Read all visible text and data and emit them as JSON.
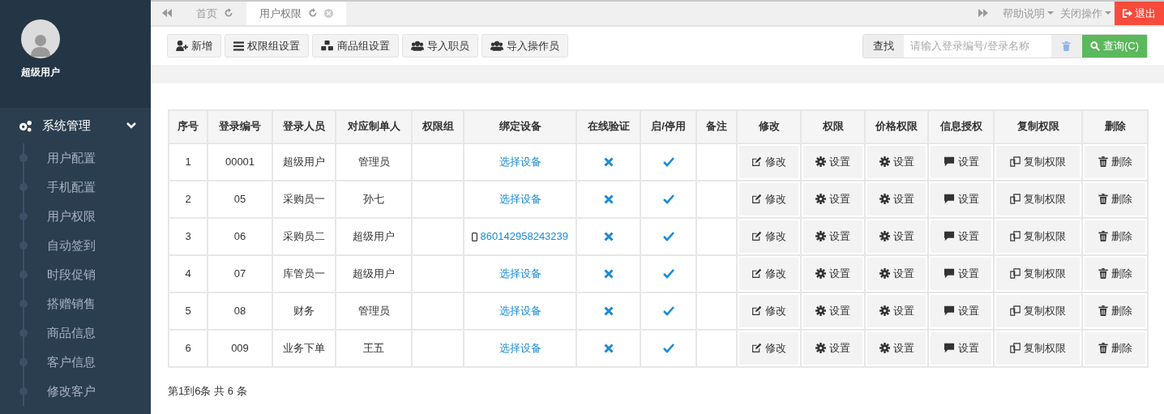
{
  "user": {
    "name": "超级用户"
  },
  "sidebar": {
    "section": {
      "label": "系统管理",
      "expanded": true
    },
    "items": [
      {
        "label": "用户配置",
        "selected": false
      },
      {
        "label": "手机配置",
        "selected": false
      },
      {
        "label": "用户权限",
        "selected": false
      },
      {
        "label": "自动签到",
        "selected": false
      },
      {
        "label": "时段促销",
        "selected": false
      },
      {
        "label": "搭赠销售",
        "selected": false
      },
      {
        "label": "商品信息",
        "selected": false
      },
      {
        "label": "客户信息",
        "selected": false
      },
      {
        "label": "修改客户",
        "selected": false
      }
    ]
  },
  "tabs": [
    {
      "label": "首页",
      "selected": false,
      "closable": false
    },
    {
      "label": "用户权限",
      "selected": true,
      "closable": true
    }
  ],
  "top_menu": [
    {
      "label": "帮助说明"
    },
    {
      "label": "关闭操作"
    }
  ],
  "logout": {
    "label": "退出"
  },
  "toolbar": [
    {
      "kind": "add",
      "label": "新增"
    },
    {
      "kind": "list",
      "label": "权限组设置"
    },
    {
      "kind": "cubes",
      "label": "商品组设置"
    },
    {
      "kind": "users",
      "label": "导入职员"
    },
    {
      "kind": "users",
      "label": "导入操作员"
    }
  ],
  "search": {
    "label": "查找",
    "placeholder": "请输入登录编号/登录名称",
    "button": "查询(C)"
  },
  "table": {
    "columns": [
      "序号",
      "登录编号",
      "登录人员",
      "对应制单人",
      "权限组",
      "绑定设备",
      "在线验证",
      "启/停用",
      "备注",
      "修改",
      "权限",
      "价格权限",
      "信息授权",
      "复制权限",
      "删除"
    ],
    "rows": [
      {
        "no": "1",
        "code": "00001",
        "user": "超级用户",
        "maker": "管理员",
        "device": {
          "kind": "select",
          "text": "选择设备"
        },
        "online_check": false,
        "enabled": true,
        "actions": [
          {
            "kind": "edit",
            "label": "修改"
          },
          {
            "kind": "gear",
            "label": "设置"
          },
          {
            "kind": "gear",
            "label": "设置"
          },
          {
            "kind": "comment",
            "label": "设置"
          },
          {
            "kind": "copy",
            "label": "复制权限"
          },
          {
            "kind": "trash",
            "label": "删除"
          }
        ]
      },
      {
        "no": "2",
        "code": "05",
        "user": "采购员一",
        "maker": "孙七",
        "device": {
          "kind": "select",
          "text": "选择设备"
        },
        "online_check": false,
        "enabled": true,
        "actions": [
          {
            "kind": "edit",
            "label": "修改"
          },
          {
            "kind": "gear",
            "label": "设置"
          },
          {
            "kind": "gear",
            "label": "设置"
          },
          {
            "kind": "comment",
            "label": "设置"
          },
          {
            "kind": "copy",
            "label": "复制权限"
          },
          {
            "kind": "trash",
            "label": "删除"
          }
        ]
      },
      {
        "no": "3",
        "code": "06",
        "user": "采购员二",
        "maker": "超级用户",
        "device": {
          "kind": "phone",
          "text": "860142958243239"
        },
        "online_check": false,
        "enabled": true,
        "actions": [
          {
            "kind": "edit",
            "label": "修改"
          },
          {
            "kind": "gear",
            "label": "设置"
          },
          {
            "kind": "gear",
            "label": "设置"
          },
          {
            "kind": "comment",
            "label": "设置"
          },
          {
            "kind": "copy",
            "label": "复制权限"
          },
          {
            "kind": "trash",
            "label": "删除"
          }
        ]
      },
      {
        "no": "4",
        "code": "07",
        "user": "库管员一",
        "maker": "超级用户",
        "device": {
          "kind": "select",
          "text": "选择设备"
        },
        "online_check": false,
        "enabled": true,
        "actions": [
          {
            "kind": "edit",
            "label": "修改"
          },
          {
            "kind": "gear",
            "label": "设置"
          },
          {
            "kind": "gear",
            "label": "设置"
          },
          {
            "kind": "comment",
            "label": "设置"
          },
          {
            "kind": "copy",
            "label": "复制权限"
          },
          {
            "kind": "trash",
            "label": "删除"
          }
        ]
      },
      {
        "no": "5",
        "code": "08",
        "user": "财务",
        "maker": "管理员",
        "device": {
          "kind": "select",
          "text": "选择设备"
        },
        "online_check": false,
        "enabled": true,
        "actions": [
          {
            "kind": "edit",
            "label": "修改"
          },
          {
            "kind": "gear",
            "label": "设置"
          },
          {
            "kind": "gear",
            "label": "设置"
          },
          {
            "kind": "comment",
            "label": "设置"
          },
          {
            "kind": "copy",
            "label": "复制权限"
          },
          {
            "kind": "trash",
            "label": "删除"
          }
        ]
      },
      {
        "no": "6",
        "code": "009",
        "user": "业务下单",
        "maker": "王五",
        "device": {
          "kind": "select",
          "text": "选择设备"
        },
        "online_check": false,
        "enabled": true,
        "actions": [
          {
            "kind": "edit",
            "label": "修改"
          },
          {
            "kind": "gear",
            "label": "设置"
          },
          {
            "kind": "gear",
            "label": "设置"
          },
          {
            "kind": "comment",
            "label": "设置"
          },
          {
            "kind": "copy",
            "label": "复制权限"
          },
          {
            "kind": "trash",
            "label": "删除"
          }
        ]
      }
    ]
  },
  "pagination": {
    "summary": "第1到6条 共 6 条"
  }
}
